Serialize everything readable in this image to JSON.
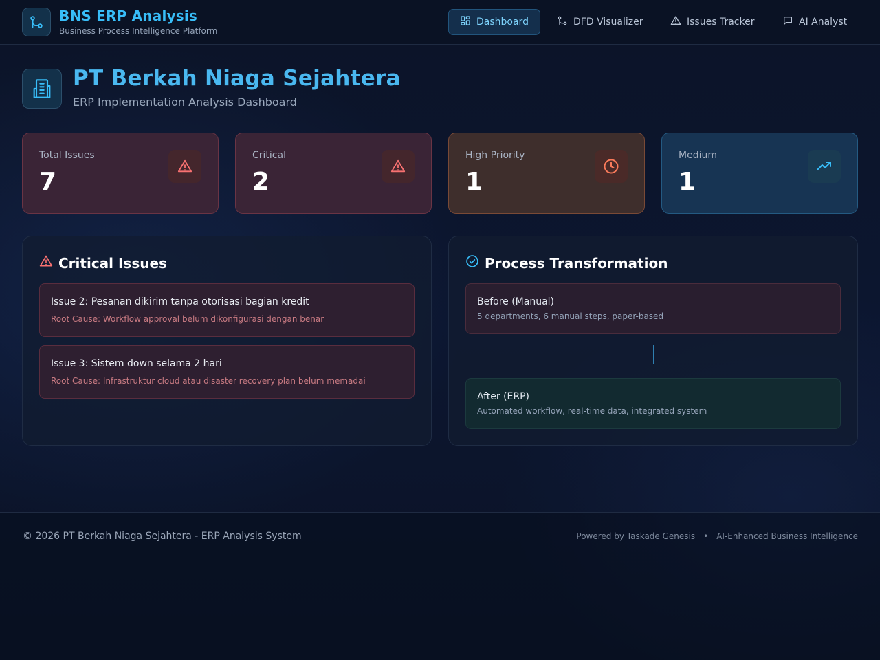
{
  "header": {
    "title": "BNS ERP Analysis",
    "subtitle": "Business Process Intelligence Platform",
    "nav": [
      {
        "label": "Dashboard",
        "icon": "dashboard-icon",
        "active": true
      },
      {
        "label": "DFD Visualizer",
        "icon": "git-branch-icon",
        "active": false
      },
      {
        "label": "Issues Tracker",
        "icon": "warning-icon",
        "active": false
      },
      {
        "label": "AI Analyst",
        "icon": "chat-icon",
        "active": false
      }
    ]
  },
  "hero": {
    "title": "PT Berkah Niaga Sejahtera",
    "subtitle": "ERP Implementation Analysis Dashboard"
  },
  "stats": [
    {
      "label": "Total Issues",
      "value": "7",
      "icon": "warning-icon",
      "accent": "#f87171"
    },
    {
      "label": "Critical",
      "value": "2",
      "icon": "warning-icon",
      "accent": "#f87171"
    },
    {
      "label": "High Priority",
      "value": "1",
      "icon": "clock-icon",
      "accent": "#fb7b5b"
    },
    {
      "label": "Medium",
      "value": "1",
      "icon": "trending-up-icon",
      "accent": "#38bdf8"
    }
  ],
  "critical_issues": {
    "title": "Critical Issues",
    "items": [
      {
        "title": "Issue 2: Pesanan dikirim tanpa otorisasi bagian kredit",
        "root_cause": "Root Cause: Workflow approval belum dikonfigurasi dengan benar"
      },
      {
        "title": "Issue 3: Sistem down selama 2 hari",
        "root_cause": "Root Cause: Infrastruktur cloud atau disaster recovery plan belum memadai"
      }
    ]
  },
  "transformation": {
    "title": "Process Transformation",
    "before": {
      "title": "Before (Manual)",
      "desc": "5 departments, 6 manual steps, paper-based"
    },
    "after": {
      "title": "After (ERP)",
      "desc": "Automated workflow, real-time data, integrated system"
    }
  },
  "footer": {
    "copyright": "© 2026 PT Berkah Niaga Sejahtera - ERP Analysis System",
    "powered": "Powered by Taskade Genesis",
    "separator": "•",
    "tagline": "AI-Enhanced Business Intelligence"
  },
  "colors": {
    "accent": "#38bdf8",
    "critical": "#f87171",
    "high": "#fb7b5b",
    "success": "#2dd4bf"
  }
}
